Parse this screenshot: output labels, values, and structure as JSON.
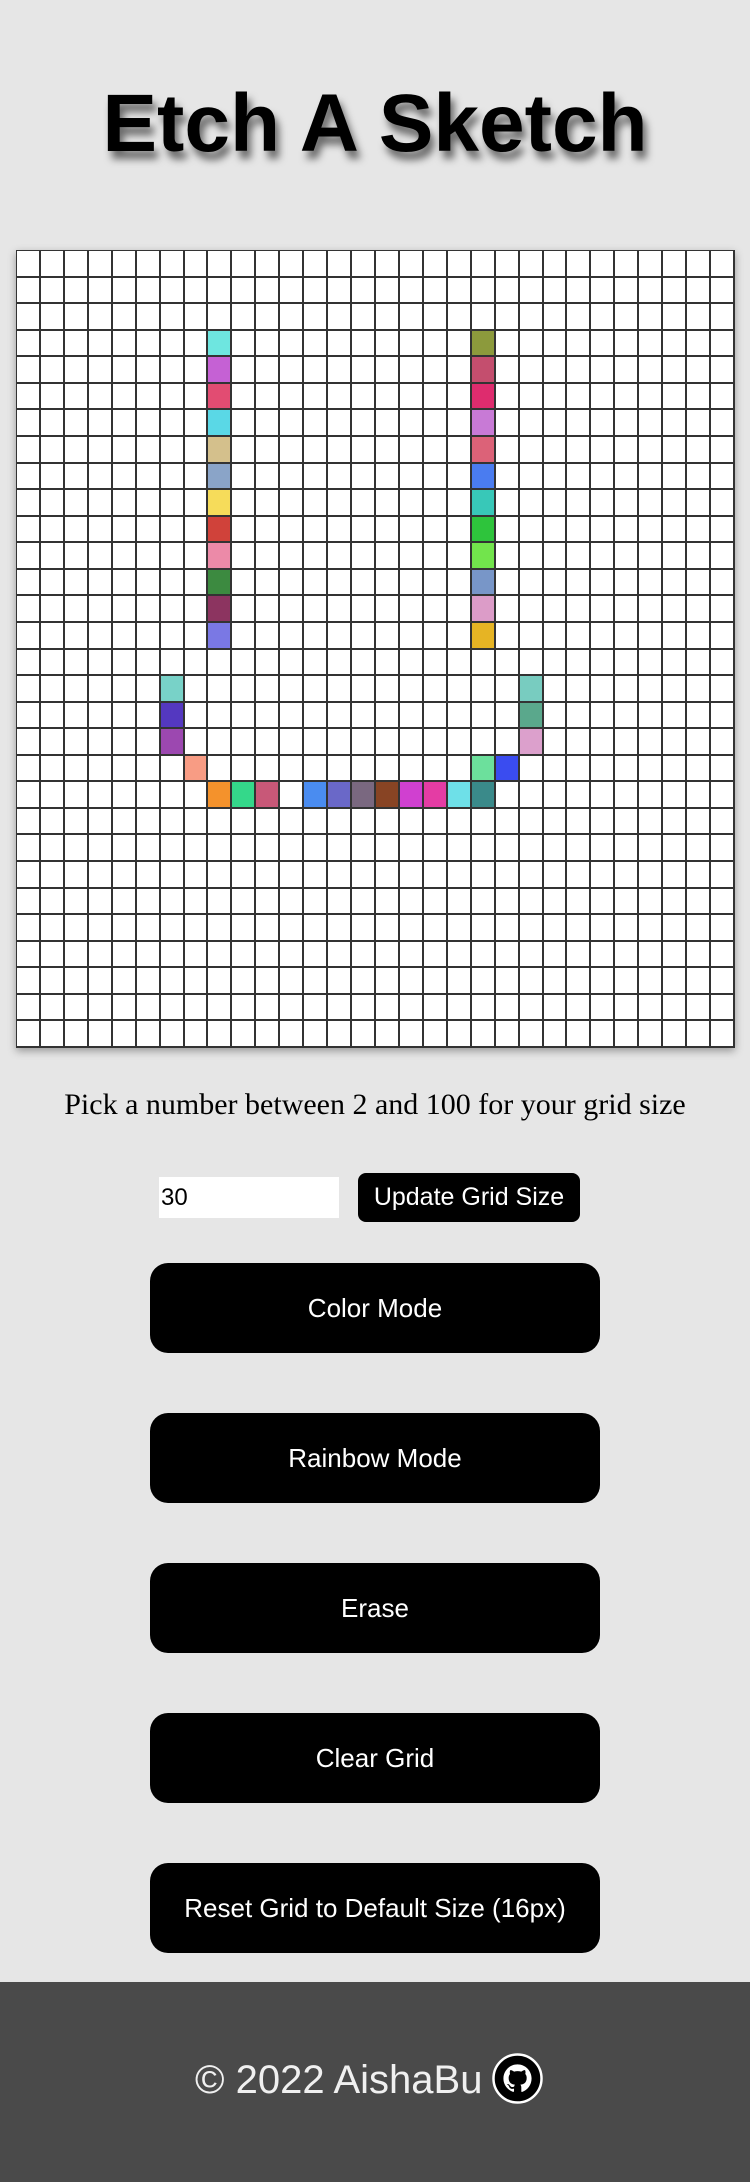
{
  "header": {
    "title": "Etch A Sketch"
  },
  "grid": {
    "size": 30,
    "default_color": "#ffffff",
    "line_color": "#333333",
    "painted_cells": [
      {
        "r": 3,
        "c": 8,
        "color": "#6ee6e0"
      },
      {
        "r": 4,
        "c": 8,
        "color": "#c561d4"
      },
      {
        "r": 5,
        "c": 8,
        "color": "#e24c72"
      },
      {
        "r": 6,
        "c": 8,
        "color": "#5ad8e6"
      },
      {
        "r": 7,
        "c": 8,
        "color": "#d4c08c"
      },
      {
        "r": 8,
        "c": 8,
        "color": "#8aa4c8"
      },
      {
        "r": 9,
        "c": 8,
        "color": "#f6dc5a"
      },
      {
        "r": 10,
        "c": 8,
        "color": "#d0423a"
      },
      {
        "r": 11,
        "c": 8,
        "color": "#ec8aa8"
      },
      {
        "r": 12,
        "c": 8,
        "color": "#3c8a40"
      },
      {
        "r": 13,
        "c": 8,
        "color": "#8c3460"
      },
      {
        "r": 14,
        "c": 8,
        "color": "#7a78e4"
      },
      {
        "r": 3,
        "c": 19,
        "color": "#8c9a3c"
      },
      {
        "r": 4,
        "c": 19,
        "color": "#c44e6e"
      },
      {
        "r": 5,
        "c": 19,
        "color": "#de2c6e"
      },
      {
        "r": 6,
        "c": 19,
        "color": "#c87ad6"
      },
      {
        "r": 7,
        "c": 19,
        "color": "#dc6278"
      },
      {
        "r": 8,
        "c": 19,
        "color": "#4a7cf0"
      },
      {
        "r": 9,
        "c": 19,
        "color": "#38c8b8"
      },
      {
        "r": 10,
        "c": 19,
        "color": "#2ec43c"
      },
      {
        "r": 11,
        "c": 19,
        "color": "#72e44c"
      },
      {
        "r": 12,
        "c": 19,
        "color": "#7896c8"
      },
      {
        "r": 13,
        "c": 19,
        "color": "#dc9cc8"
      },
      {
        "r": 14,
        "c": 19,
        "color": "#e6b424"
      },
      {
        "r": 16,
        "c": 6,
        "color": "#78d2c8"
      },
      {
        "r": 17,
        "c": 6,
        "color": "#5438c0"
      },
      {
        "r": 18,
        "c": 6,
        "color": "#9c48b0"
      },
      {
        "r": 19,
        "c": 7,
        "color": "#f89c84"
      },
      {
        "r": 20,
        "c": 8,
        "color": "#f4922c"
      },
      {
        "r": 20,
        "c": 9,
        "color": "#34d88a"
      },
      {
        "r": 20,
        "c": 10,
        "color": "#c85878"
      },
      {
        "r": 20,
        "c": 12,
        "color": "#4a8cf0"
      },
      {
        "r": 20,
        "c": 13,
        "color": "#6a68c8"
      },
      {
        "r": 20,
        "c": 14,
        "color": "#7a6880"
      },
      {
        "r": 20,
        "c": 15,
        "color": "#884424"
      },
      {
        "r": 20,
        "c": 16,
        "color": "#d040d0"
      },
      {
        "r": 20,
        "c": 17,
        "color": "#e43ca4"
      },
      {
        "r": 20,
        "c": 18,
        "color": "#6ee0e8"
      },
      {
        "r": 20,
        "c": 19,
        "color": "#3a8a8a"
      },
      {
        "r": 19,
        "c": 19,
        "color": "#6ce09c"
      },
      {
        "r": 19,
        "c": 20,
        "color": "#3a4cf0"
      },
      {
        "r": 16,
        "c": 21,
        "color": "#78ccc0"
      },
      {
        "r": 17,
        "c": 21,
        "color": "#5aa88c"
      },
      {
        "r": 18,
        "c": 21,
        "color": "#dca0cc"
      }
    ]
  },
  "controls": {
    "prompt": "Pick a number between 2 and 100 for your grid size",
    "grid_size_value": "30",
    "update_label": "Update Grid Size",
    "color_mode_label": "Color Mode",
    "rainbow_mode_label": "Rainbow Mode",
    "erase_label": "Erase",
    "clear_label": "Clear Grid",
    "reset_label": "Reset Grid to Default Size (16px)"
  },
  "footer": {
    "text": "© 2022 AishaBu",
    "icon": "github-icon"
  }
}
